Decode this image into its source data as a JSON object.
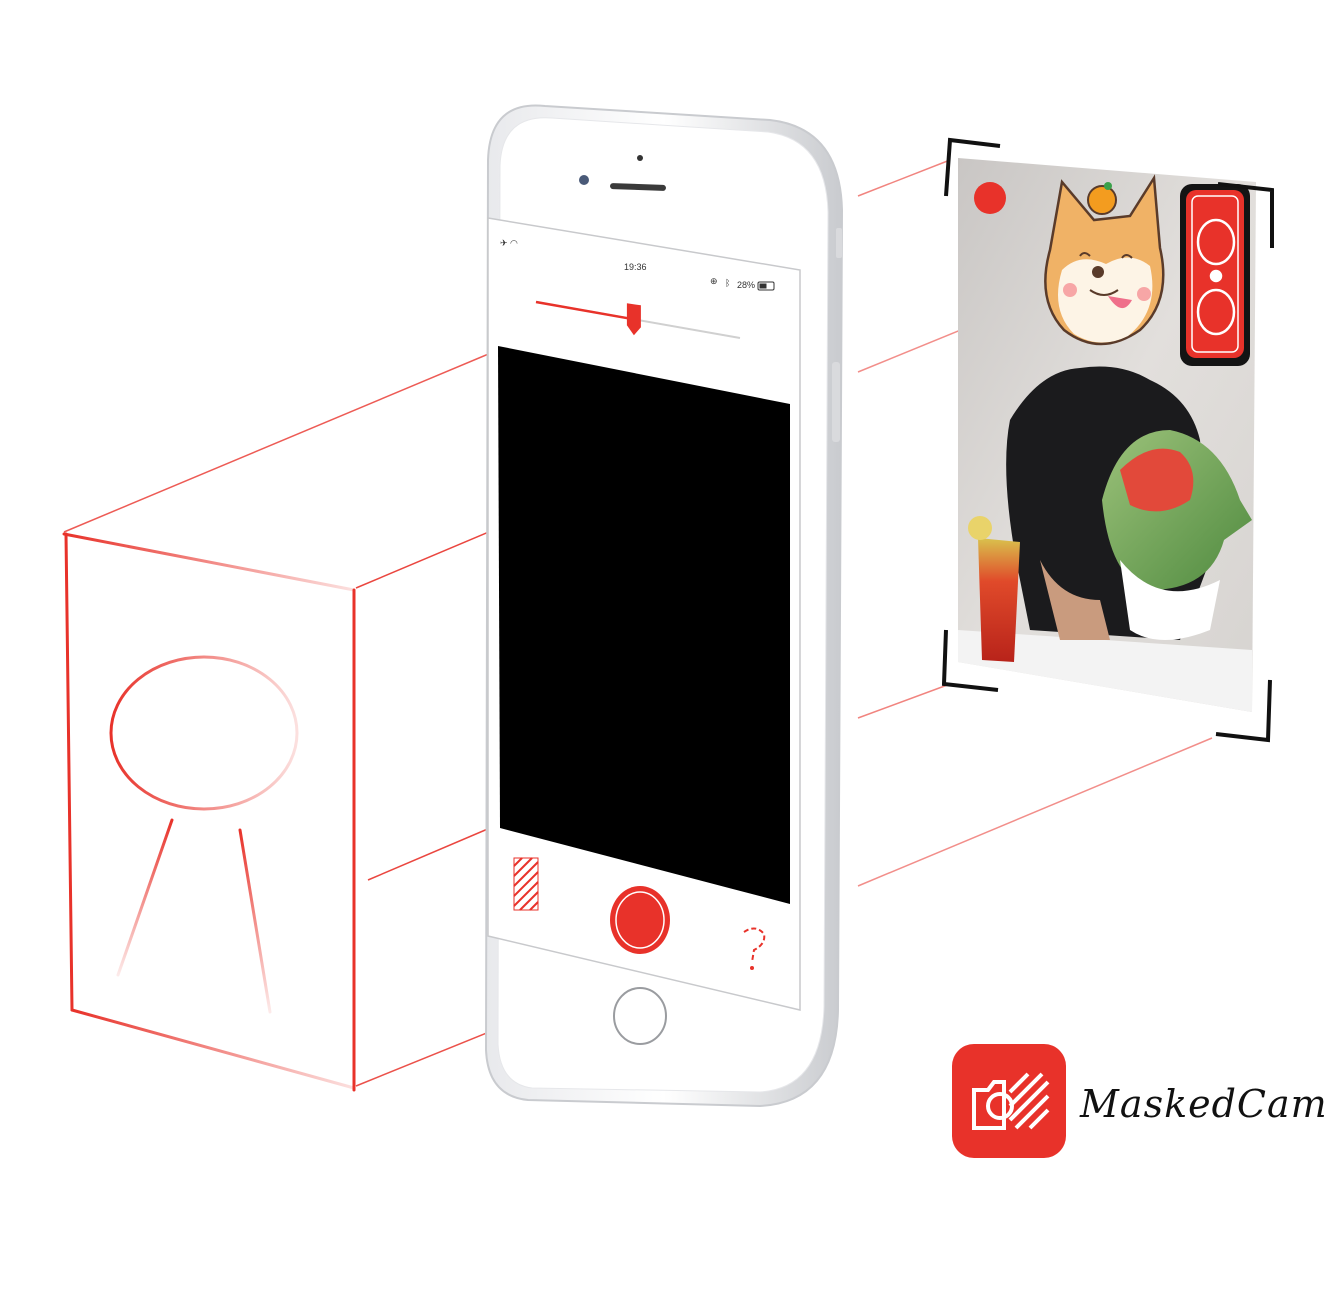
{
  "status_bar": {
    "time": "19:36",
    "battery_percent": "28%",
    "left_icons": [
      "airplane-icon",
      "wifi-icon"
    ],
    "right_icons": [
      "location-icon",
      "bluetooth-icon",
      "battery-icon"
    ]
  },
  "exposure_slider": {
    "value": 0.48
  },
  "controls": {
    "left_icon": "striped-mask-icon",
    "center_icon": "shutter-button",
    "right_icon": "question-icon"
  },
  "preview_card": {
    "record_indicator": "record-dot-icon",
    "toggle_icon": "camera-switch-icon"
  },
  "brand": {
    "name": "MaskedCam",
    "icon": "maskedcam-logo-icon"
  },
  "colors": {
    "accent": "#e8322a",
    "phone_body": "#f2f3f5",
    "screen_black": "#000000"
  }
}
